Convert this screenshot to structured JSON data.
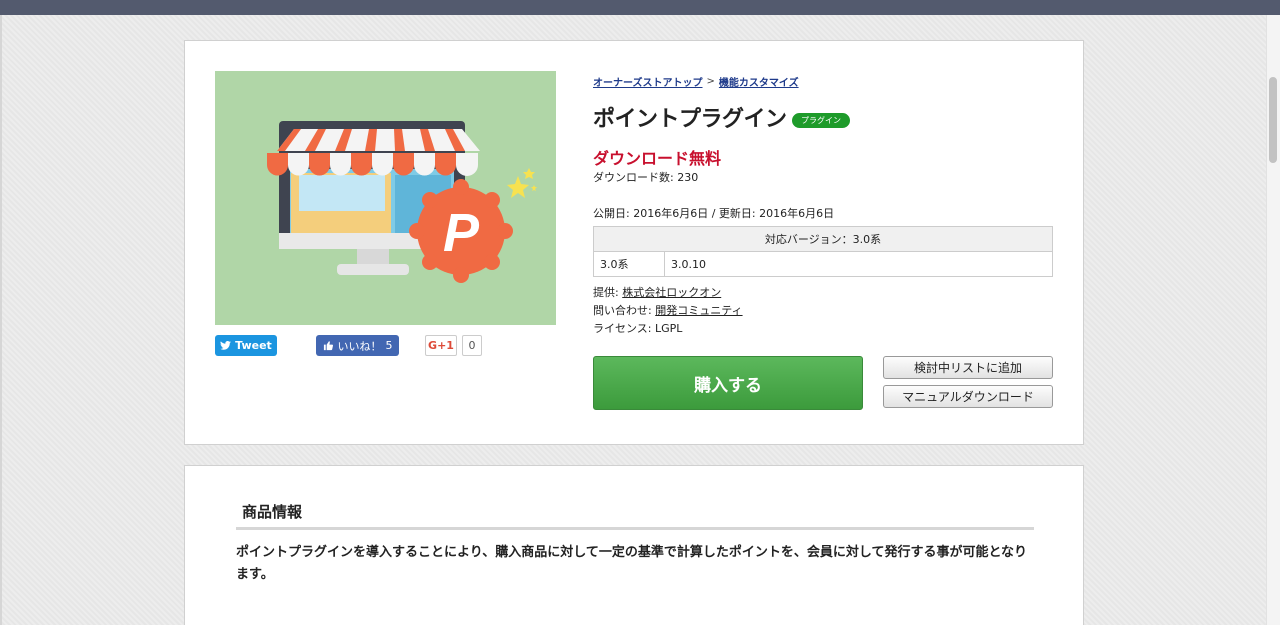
{
  "breadcrumb": {
    "items": [
      "オーナーズストアトップ",
      "機能カスタマイズ"
    ],
    "separator": ">"
  },
  "product": {
    "title": "ポイントプラグイン",
    "badge": "プラグイン",
    "price_label": "ダウンロード無料",
    "download_count": "ダウンロード数: 230",
    "dates": "公開日: 2016年6月6日 / 更新日: 2016年6月6日",
    "image_letter": "P"
  },
  "version_table": {
    "header": "対応バージョン：3.0系",
    "rows": [
      {
        "series": "3.0系",
        "versions": "3.0.10"
      }
    ]
  },
  "meta": {
    "provider_label": "提供:",
    "provider": "株式会社ロックオン",
    "contact_label": "問い合わせ:",
    "contact": "開発コミュニティ",
    "license": "ライセンス: LGPL"
  },
  "social": {
    "tweet_label": "Tweet",
    "like_label": "いいね！",
    "like_count": "5",
    "gplus_label": "G+1",
    "gplus_count": "0"
  },
  "actions": {
    "buy_label": "購入する",
    "wishlist_label": "検討中リストに追加",
    "manual_label": "マニュアルダウンロード"
  },
  "info": {
    "section_title": "商品情報",
    "description": "ポイントプラグインを導入することにより、購入商品に対して一定の基準で計算したポイントを、会員に対して発行する事が可能となります。"
  },
  "colors": {
    "topbar": "#535a6e",
    "price": "#c8102e",
    "badge": "#1e9b2a",
    "buy_button": "#4cae4c",
    "image_background": "#b0d6a7",
    "sticker": "#f06a43"
  }
}
